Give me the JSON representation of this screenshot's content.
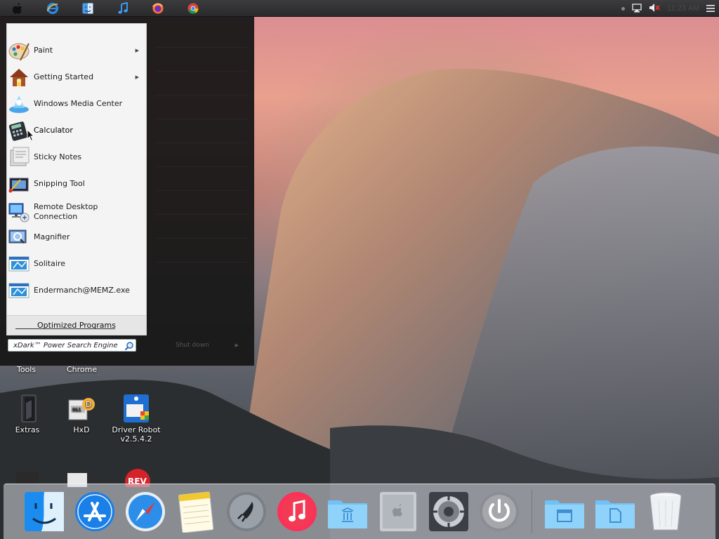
{
  "menubar": {
    "icons": [
      "apple-icon",
      "internet-explorer-icon",
      "finder-face-icon",
      "music-note-icon",
      "firefox-icon",
      "chrome-icon"
    ],
    "tray": {
      "clock": "11:23 AM",
      "icons": [
        "dot-icon",
        "network-icon",
        "volume-muted-icon",
        "menu-icon"
      ]
    }
  },
  "start_menu": {
    "programs": [
      {
        "label": "Paint",
        "icon": "paint-palette-icon",
        "has_submenu": true
      },
      {
        "label": "Getting Started",
        "icon": "getting-started-icon",
        "has_submenu": true
      },
      {
        "label": "Windows Media Center",
        "icon": "media-center-icon",
        "has_submenu": false
      },
      {
        "label": "Calculator",
        "icon": "calculator-icon",
        "has_submenu": false
      },
      {
        "label": "Sticky Notes",
        "icon": "sticky-notes-icon",
        "has_submenu": false
      },
      {
        "label": "Snipping Tool",
        "icon": "snipping-tool-icon",
        "has_submenu": false
      },
      {
        "label": "Remote Desktop Connection",
        "icon": "remote-desktop-icon",
        "has_submenu": false
      },
      {
        "label": "Magnifier",
        "icon": "magnifier-icon",
        "has_submenu": false
      },
      {
        "label": "Solitaire",
        "icon": "solitaire-icon",
        "has_submenu": false
      },
      {
        "label": "Endermanch@MEMZ.exe",
        "icon": "exe-window-icon",
        "has_submenu": false
      }
    ],
    "all_programs_label": "Optimized Programs",
    "search_placeholder": "xDark™ Power Search Engine",
    "shutdown_label": "Shut down"
  },
  "desktop": {
    "icons": [
      {
        "label": "Extras",
        "icon": "extras-folder-icon"
      },
      {
        "label": "HxD",
        "icon": "hxd-icon"
      },
      {
        "label": "Driver Robot v2.5.4.2",
        "icon": "driver-robot-icon"
      }
    ],
    "partial_labels": [
      "Tools",
      "Chrome"
    ]
  },
  "dock": {
    "items": [
      "finder-icon",
      "app-store-icon",
      "safari-icon",
      "notes-icon",
      "launchpad-icon",
      "itunes-icon",
      "applications-folder-icon",
      "mac-pro-icon",
      "system-preferences-icon",
      "power-icon"
    ],
    "stacks": [
      "documents-folder-icon",
      "downloads-folder-icon",
      "trash-icon"
    ]
  },
  "colors": {
    "menubar": "#2f2f31",
    "start_panel": "#161616",
    "program_list_bg": "#f4f4f4"
  }
}
